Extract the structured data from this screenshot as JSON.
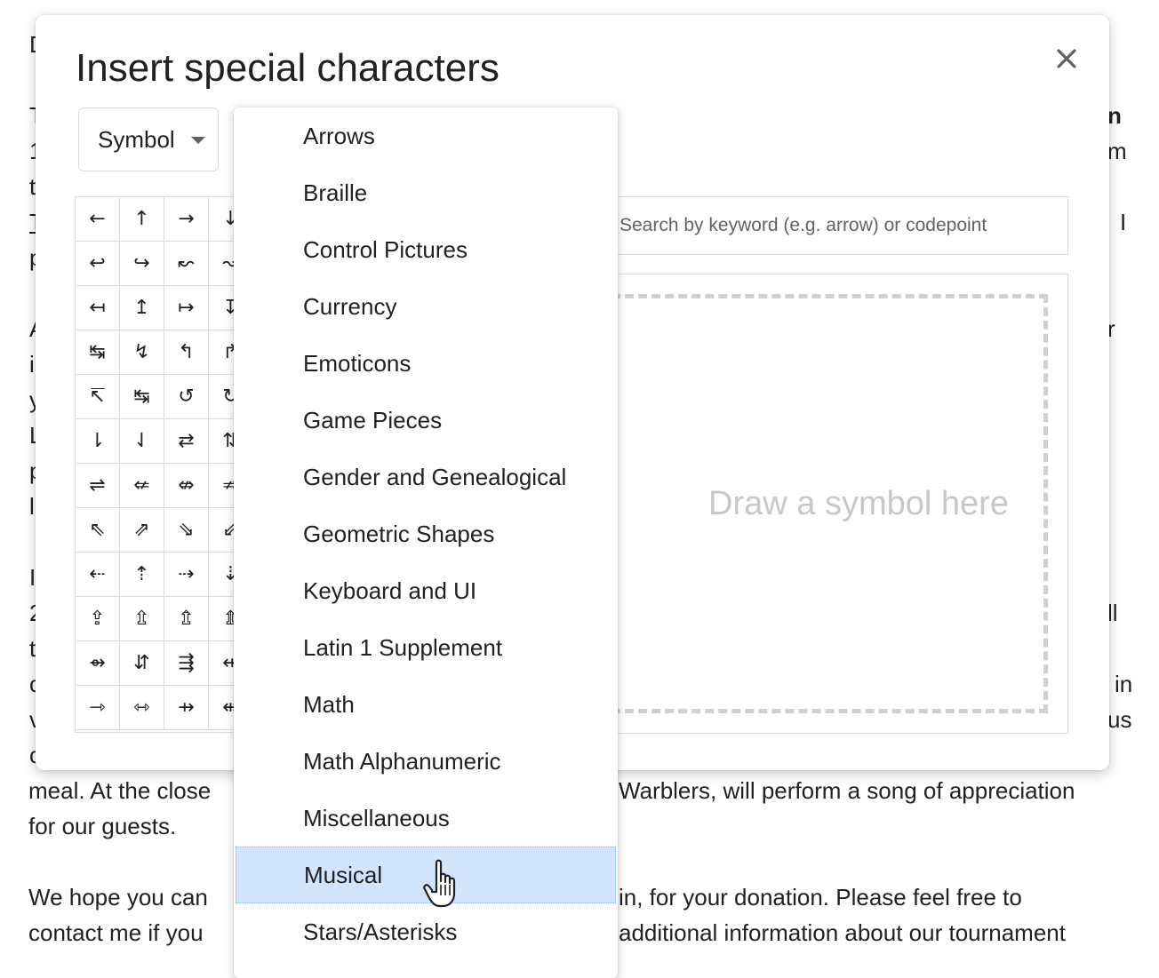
{
  "document": {
    "lines": [
      {
        "text": "meal. At the close"
      },
      {
        "text": "for our guests."
      },
      {
        "text": "We hope you can"
      },
      {
        "text": "contact me if you"
      }
    ],
    "right_fragments": [
      {
        "text": "Warblers, will perform a song of appreciation"
      },
      {
        "text": "in, for your donation. Please feel free to"
      },
      {
        "text": "additional information about our tournament"
      }
    ],
    "left_edge_chars": [
      "D",
      "T",
      "1",
      "t",
      "T",
      "p",
      "A",
      "i",
      "y",
      "L",
      "p",
      "l",
      "I",
      "2",
      "t",
      "c",
      "v",
      "c"
    ],
    "right_edge_chars": [
      "n",
      "m",
      "I",
      "r",
      "ll",
      "in",
      "us"
    ]
  },
  "dialog": {
    "title": "Insert special characters",
    "close_icon": "close-icon",
    "category_select": {
      "value": "Symbol"
    },
    "search": {
      "placeholder": "Search by keyword (e.g. arrow) or codepoint"
    },
    "draw_hint": "Draw a symbol here",
    "symbols": [
      "←",
      "↑",
      "→",
      "↓",
      "↩",
      "↪",
      "↜",
      "↝",
      "↤",
      "↥",
      "↦",
      "↧",
      "↹",
      "↯",
      "↰",
      "↱",
      "↸",
      "↹",
      "↺",
      "↻",
      "⇂",
      "⇃",
      "⇄",
      "⇅",
      "⇌",
      "⇍",
      "⇎",
      "⇏",
      "⇖",
      "⇗",
      "⇘",
      "⇙",
      "⇠",
      "⇡",
      "⇢",
      "⇣",
      "⇪",
      "⇫",
      "⇬",
      "⇭",
      "⇴",
      "⇵",
      "⇶",
      "⇷",
      "⇾",
      "⇿",
      "⇸",
      "⇹"
    ]
  },
  "dropdown": {
    "items": [
      "Arrows",
      "Braille",
      "Control Pictures",
      "Currency",
      "Emoticons",
      "Game Pieces",
      "Gender and Genealogical",
      "Geometric Shapes",
      "Keyboard and UI",
      "Latin 1 Supplement",
      "Math",
      "Math Alphanumeric",
      "Miscellaneous",
      "Musical",
      "Stars/Asterisks"
    ],
    "highlighted": "Musical",
    "highlight_color": "#d2e3fc"
  },
  "cursor_icon": "hand-pointer-icon"
}
